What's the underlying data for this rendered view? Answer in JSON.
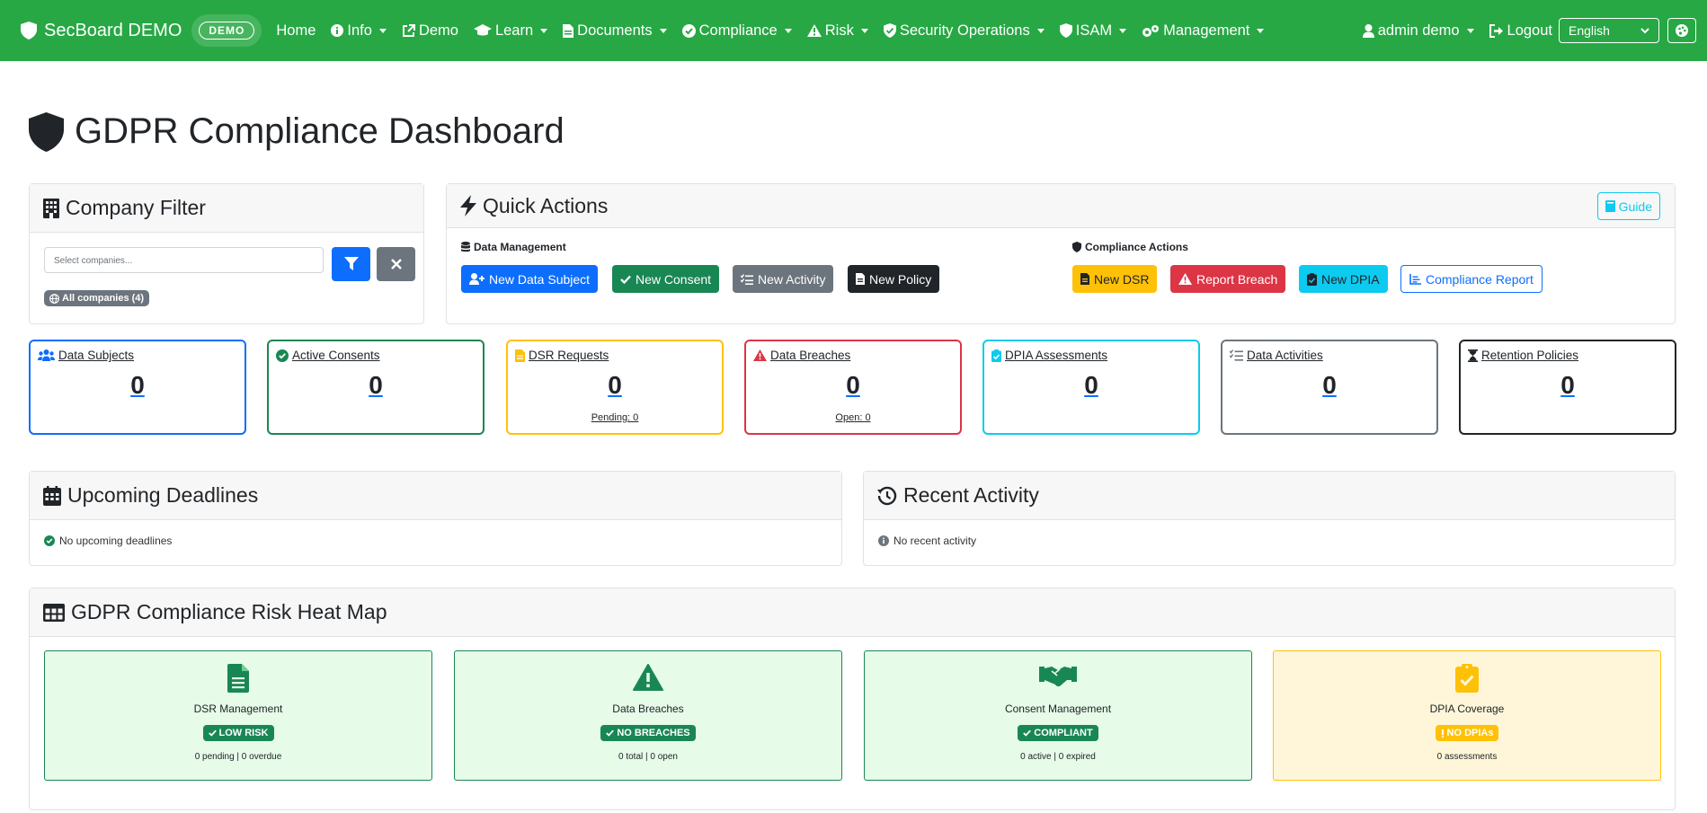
{
  "colors": {
    "navbar": "#27a844",
    "primary": "#0d6efd",
    "success": "#198754",
    "secondary": "#6c757d",
    "dark": "#212529",
    "warning": "#ffc107",
    "danger": "#dc3545",
    "info": "#0dcaf0"
  },
  "navbar": {
    "brand": "SecBoard DEMO",
    "demo_badge": "DEMO",
    "items": [
      {
        "label": "Home",
        "icon": "none"
      },
      {
        "label": "Info",
        "icon": "info-icon"
      },
      {
        "label": "Demo",
        "icon": "external-link-icon"
      },
      {
        "label": "Learn",
        "icon": "graduation-cap-icon"
      },
      {
        "label": "Documents",
        "icon": "file-icon"
      },
      {
        "label": "Compliance",
        "icon": "check-circle-icon"
      },
      {
        "label": "Risk",
        "icon": "warning-icon"
      },
      {
        "label": "Security Operations",
        "icon": "shield-check-icon"
      },
      {
        "label": "ISAM",
        "icon": "shield-icon"
      },
      {
        "label": "Management",
        "icon": "gears-icon"
      }
    ],
    "user": "admin demo",
    "logout": "Logout",
    "language": "English"
  },
  "page": {
    "title": "GDPR Compliance Dashboard"
  },
  "company_filter": {
    "title": "Company Filter",
    "placeholder": "Select companies...",
    "all_badge": "All companies (4)"
  },
  "quick_actions": {
    "title": "Quick Actions",
    "guide": "Guide",
    "data_management_label": "Data Management",
    "compliance_actions_label": "Compliance Actions",
    "data_buttons": [
      "New Data Subject",
      "New Consent",
      "New Activity",
      "New Policy"
    ],
    "compliance_buttons": [
      "New DSR",
      "Report Breach",
      "New DPIA",
      "Compliance Report"
    ]
  },
  "stats": [
    {
      "label": "Data Subjects",
      "value": "0",
      "sub": "",
      "icon": "users-icon"
    },
    {
      "label": "Active Consents",
      "value": "0",
      "sub": "",
      "icon": "check-circle-icon"
    },
    {
      "label": "DSR Requests",
      "value": "0",
      "sub": "Pending: 0",
      "icon": "file-icon"
    },
    {
      "label": "Data Breaches",
      "value": "0",
      "sub": "Open: 0",
      "icon": "warning-icon"
    },
    {
      "label": "DPIA Assessments",
      "value": "0",
      "sub": "",
      "icon": "clipboard-check-icon"
    },
    {
      "label": "Data Activities",
      "value": "0",
      "sub": "",
      "icon": "list-check-icon"
    },
    {
      "label": "Retention Policies",
      "value": "0",
      "sub": "",
      "icon": "hourglass-icon"
    }
  ],
  "deadlines": {
    "title": "Upcoming Deadlines",
    "empty": "No upcoming deadlines"
  },
  "activity": {
    "title": "Recent Activity",
    "empty": "No recent activity"
  },
  "heatmap": {
    "title": "GDPR Compliance Risk Heat Map",
    "cells": [
      {
        "title": "DSR Management",
        "badge": "LOW RISK",
        "detail": "0 pending | 0 overdue",
        "icon": "file-lines-icon",
        "level": "good"
      },
      {
        "title": "Data Breaches",
        "badge": "NO BREACHES",
        "detail": "0 total | 0 open",
        "icon": "warning-icon",
        "level": "good"
      },
      {
        "title": "Consent Management",
        "badge": "COMPLIANT",
        "detail": "0 active | 0 expired",
        "icon": "handshake-icon",
        "level": "good"
      },
      {
        "title": "DPIA Coverage",
        "badge": "NO DPIAs",
        "detail": "0 assessments",
        "icon": "clipboard-check-icon",
        "level": "warn"
      }
    ]
  }
}
